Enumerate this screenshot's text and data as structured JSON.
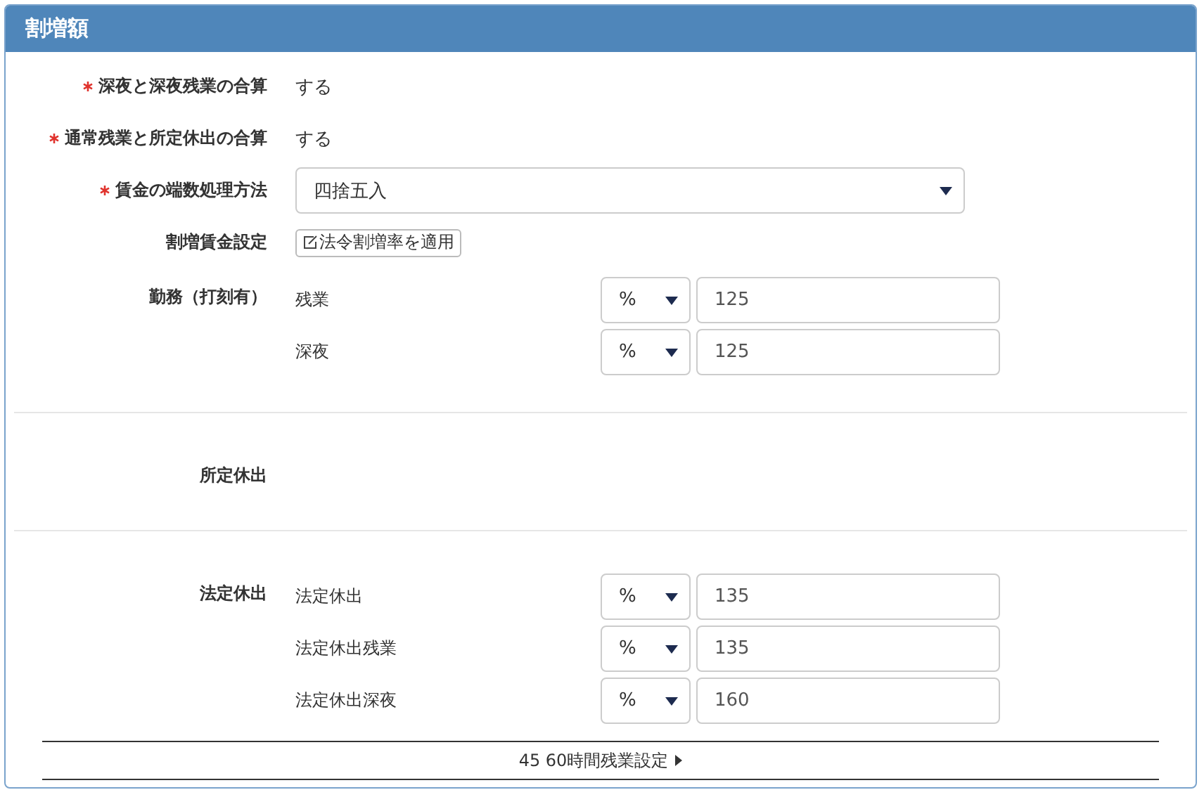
{
  "panel": {
    "title": "割増額",
    "fields": [
      {
        "kind": "text",
        "label": "深夜と深夜残業の合算",
        "required": true,
        "value": "する"
      },
      {
        "kind": "text",
        "label": "通常残業と所定休出の合算",
        "required": true,
        "value": "する"
      },
      {
        "kind": "select",
        "label": "賃金の端数処理方法",
        "required": true,
        "value": "四捨五入"
      },
      {
        "kind": "button",
        "label": "割増賃金設定",
        "required": false,
        "value": "法令割増率を適用"
      }
    ],
    "groups": [
      {
        "label": "勤務（打刻有）",
        "rates": [
          {
            "label": "残業",
            "unit": "%",
            "value": "125"
          },
          {
            "label": "深夜",
            "unit": "%",
            "value": "125"
          }
        ]
      },
      {
        "label": "所定休出"
      },
      {
        "label": "法定休出",
        "rates": [
          {
            "label": "法定休出",
            "unit": "%",
            "value": "135"
          },
          {
            "label": "法定休出残業",
            "unit": "%",
            "value": "135"
          },
          {
            "label": "法定休出深夜",
            "unit": "%",
            "value": "160"
          }
        ]
      }
    ],
    "footer": "45 60時間残業設定"
  }
}
